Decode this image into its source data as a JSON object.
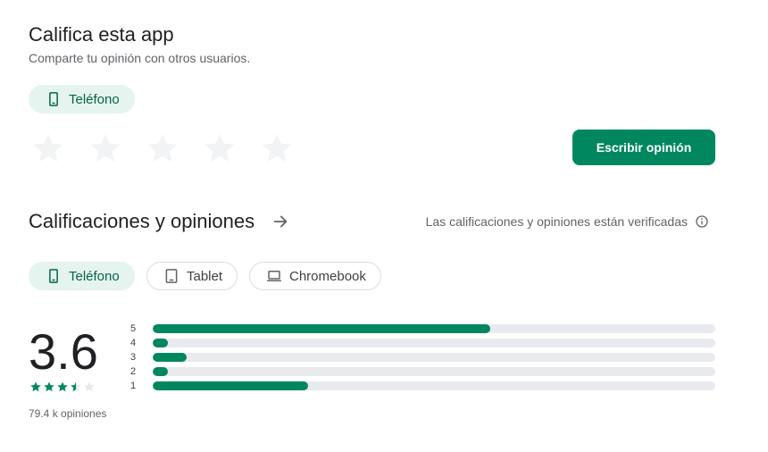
{
  "rate": {
    "title": "Califica esta app",
    "subtitle": "Comparte tu opinión con otros usuarios.",
    "device_chip": "Teléfono",
    "write_button": "Escribir opinión",
    "star_count": 5
  },
  "ratings": {
    "title": "Calificaciones y opiniones",
    "verified_text": "Las calificaciones y opiniones están verificadas",
    "device_tabs": [
      {
        "label": "Teléfono",
        "icon": "phone-icon",
        "selected": true
      },
      {
        "label": "Tablet",
        "icon": "tablet-icon",
        "selected": false
      },
      {
        "label": "Chromebook",
        "icon": "laptop-icon",
        "selected": false
      }
    ],
    "average": "3.6",
    "average_value": 3.6,
    "review_count": "79.4 k opiniones",
    "histogram": [
      {
        "label": "5",
        "fraction": 0.6
      },
      {
        "label": "4",
        "fraction": 0.027
      },
      {
        "label": "3",
        "fraction": 0.06
      },
      {
        "label": "2",
        "fraction": 0.027
      },
      {
        "label": "1",
        "fraction": 0.276
      }
    ]
  },
  "colors": {
    "accent": "#01875f",
    "chip_selected_bg": "#e6f4ef",
    "chip_selected_text": "#056449",
    "empty_star": "#f1f3f4",
    "track": "#e8eaed"
  }
}
